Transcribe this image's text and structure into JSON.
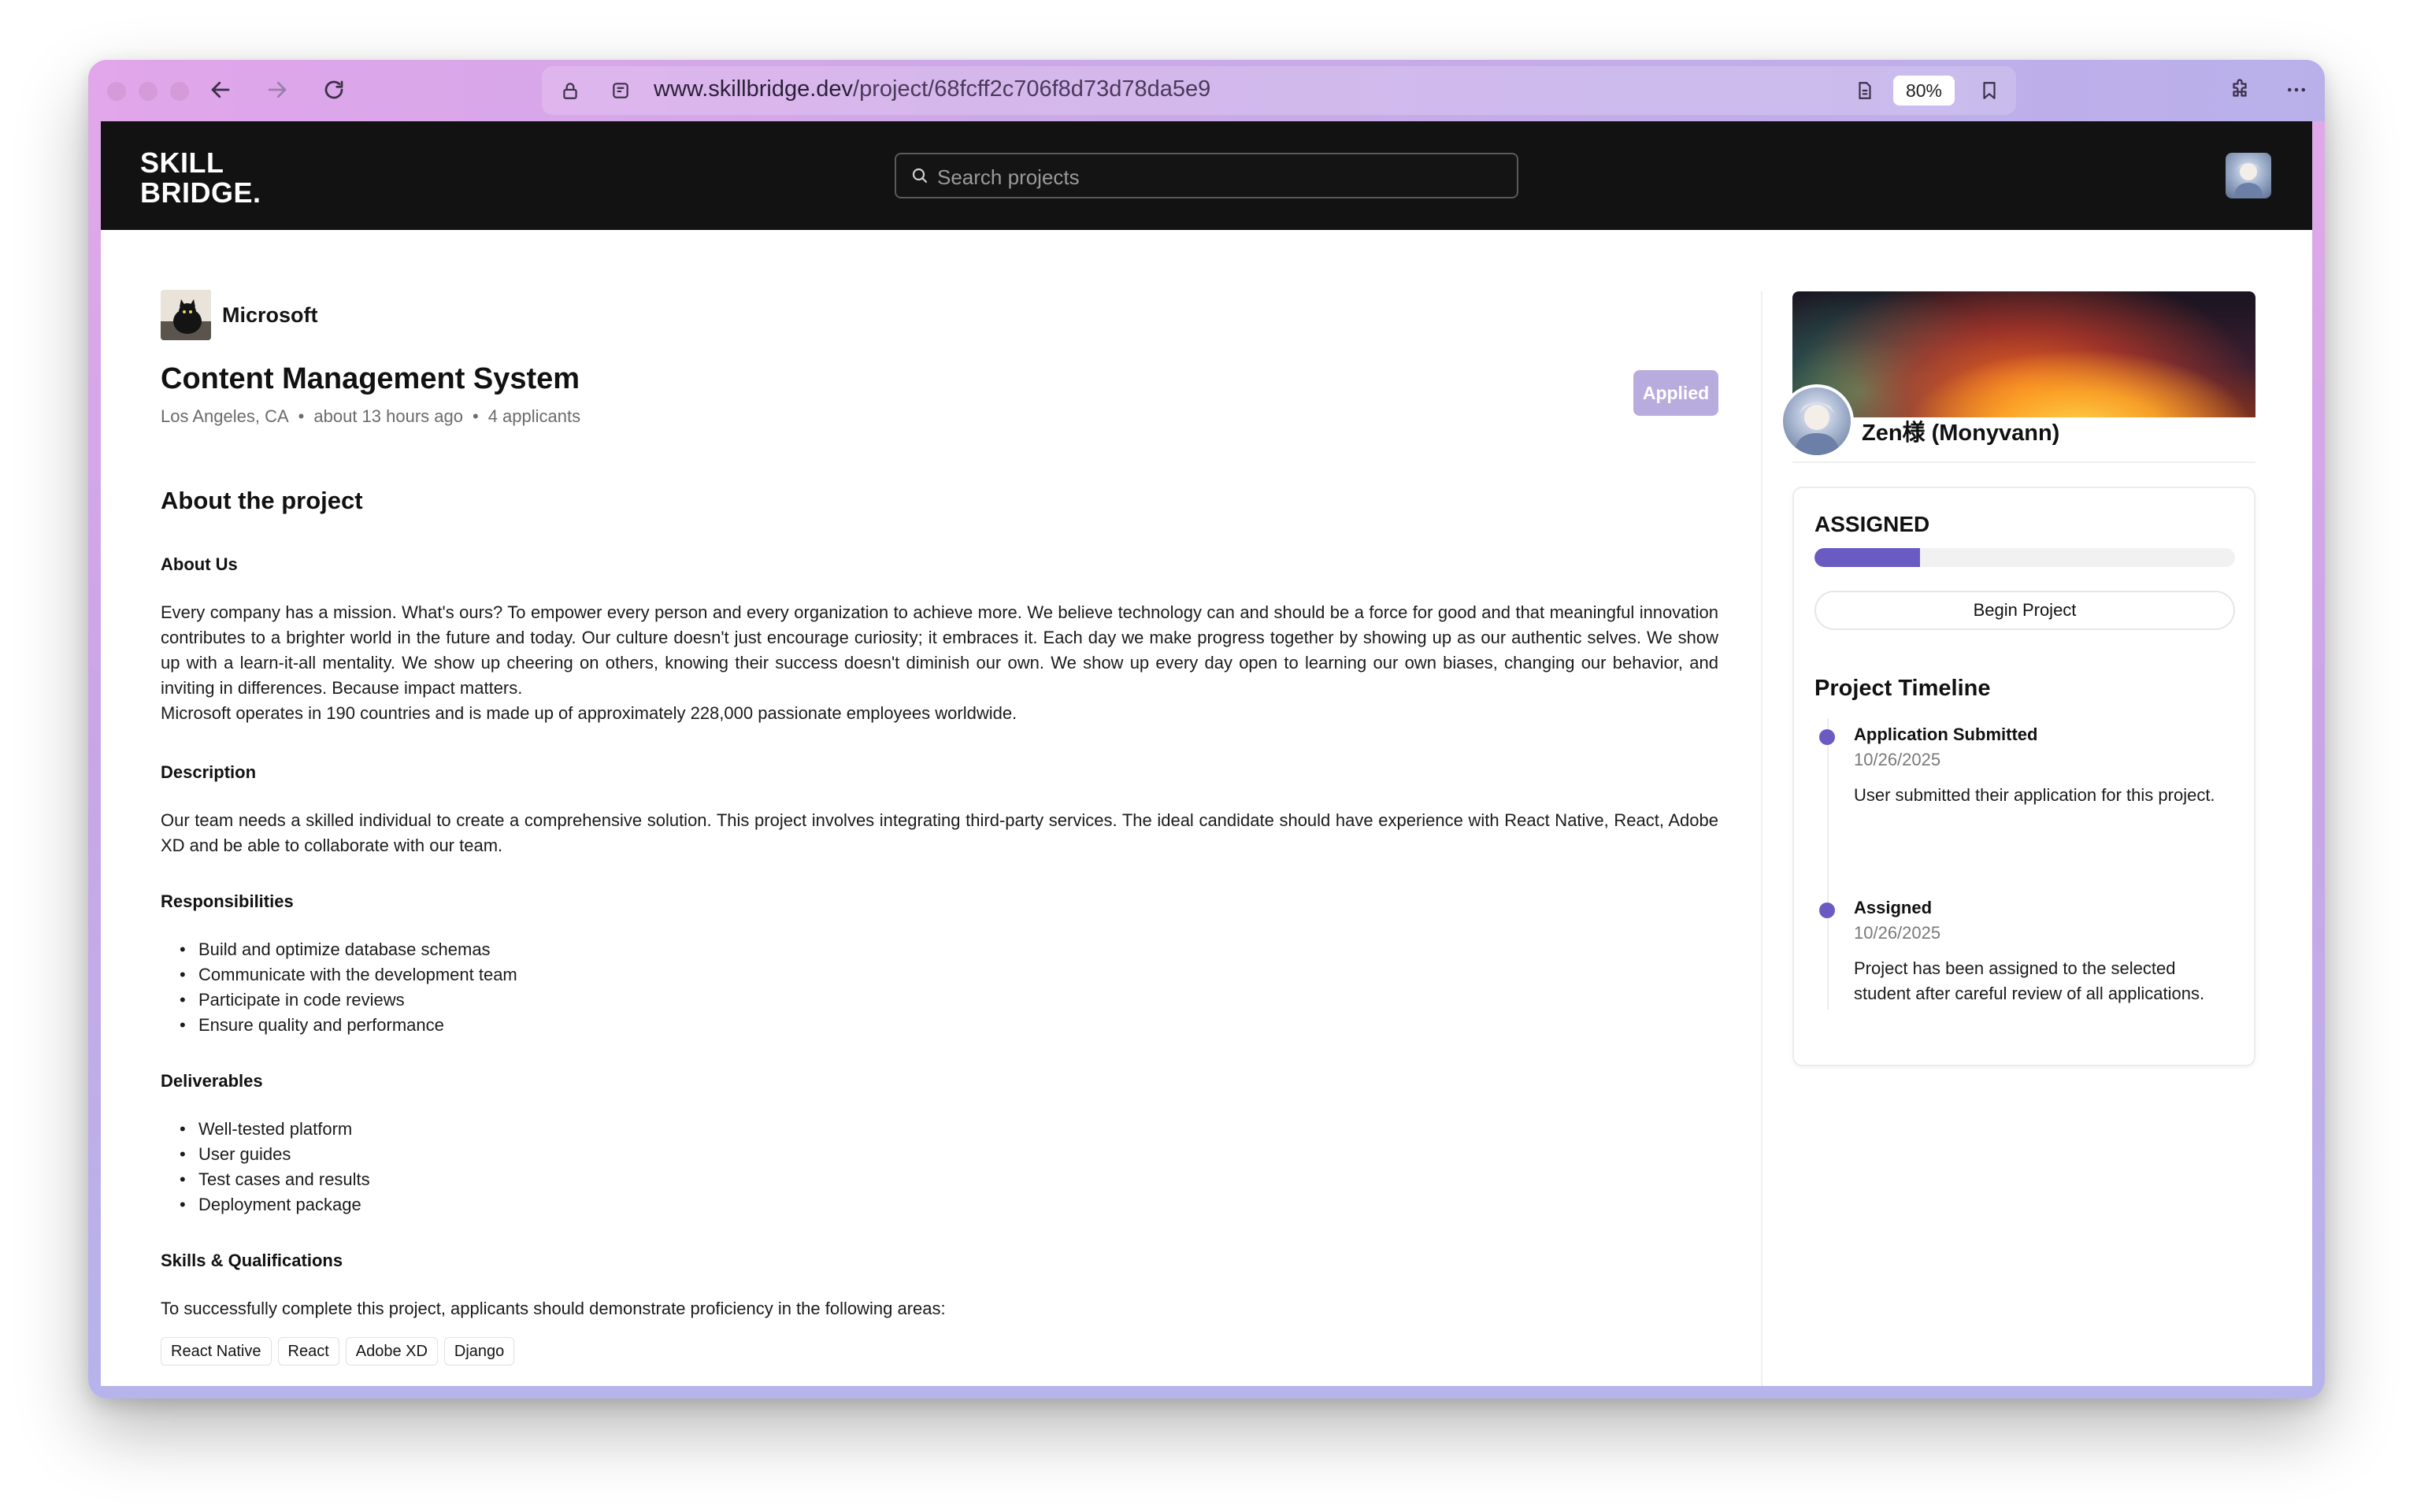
{
  "browser": {
    "url_domain": "www.skillbridge.dev",
    "url_path": "/project/68fcff2c706f8d73d78da5e9",
    "zoom": "80%"
  },
  "header": {
    "logo_line1": "SKILL",
    "logo_line2": "BRIDGE.",
    "search_placeholder": "Search projects"
  },
  "project": {
    "company": "Microsoft",
    "title": "Content Management System",
    "location": "Los Angeles, CA",
    "posted": "about 13 hours ago",
    "applicants": "4 applicants",
    "applied_label": "Applied",
    "section_title": "About the project",
    "about_us_heading": "About Us",
    "about_us_text": "Every company has a mission. What's ours? To empower every person and every organization to achieve more. We believe technology can and should be a force for good and that meaningful innovation contributes to a brighter world in the future and today. Our culture doesn't just encourage curiosity; it embraces it. Each day we make progress together by showing up as our authentic selves. We show up with a learn-it-all mentality. We show up cheering on others, knowing their success doesn't diminish our own. We show up every day open to learning our own biases, changing our behavior, and inviting in differences. Because impact matters.",
    "about_us_text2": "Microsoft operates in 190 countries and is made up of approximately 228,000 passionate employees worldwide.",
    "description_heading": "Description",
    "description_text": "Our team needs a skilled individual to create a comprehensive solution. This project involves integrating third-party services. The ideal candidate should have experience with React Native, React, Adobe XD and be able to collaborate with our team.",
    "responsibilities_heading": "Responsibilities",
    "responsibilities": [
      "Build and optimize database schemas",
      "Communicate with the development team",
      "Participate in code reviews",
      "Ensure quality and performance"
    ],
    "deliverables_heading": "Deliverables",
    "deliverables": [
      "Well-tested platform",
      "User guides",
      "Test cases and results",
      "Deployment package"
    ],
    "skills_heading": "Skills & Qualifications",
    "skills_text": "To successfully complete this project, applicants should demonstrate proficiency in the following areas:",
    "skills": [
      "React Native",
      "React",
      "Adobe XD",
      "Django"
    ]
  },
  "sidebar": {
    "profile_name": "Zen様 (Monyvann)",
    "status": "ASSIGNED",
    "progress_fraction": 0.25,
    "begin_label": "Begin Project",
    "timeline_title": "Project Timeline",
    "timeline": [
      {
        "title": "Application Submitted",
        "date": "10/26/2025",
        "desc": "User submitted their application for this project."
      },
      {
        "title": "Assigned",
        "date": "10/26/2025",
        "desc": "Project has been assigned to the selected student after careful review of all applications."
      }
    ]
  },
  "colors": {
    "accent": "#6a5bc2",
    "applied_button": "#b8acdf",
    "header_bg": "#121212"
  }
}
